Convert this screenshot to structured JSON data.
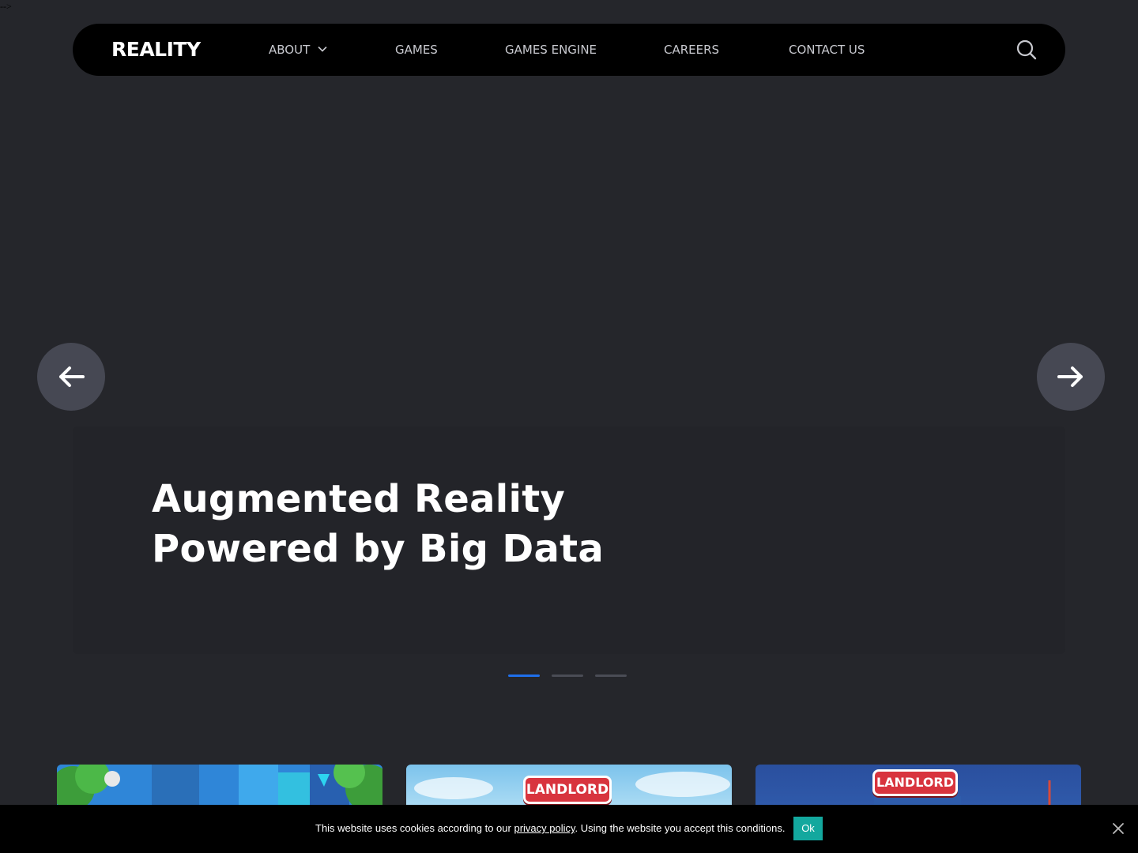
{
  "stray_text": "-->",
  "header": {
    "logo": "REALITY",
    "nav": {
      "about": "ABOUT",
      "games": "GAMES",
      "games_engine": "GAMES ENGINE",
      "careers": "CAREERS",
      "contact": "CONTACT US"
    },
    "search_icon": "search-icon"
  },
  "hero": {
    "title_line1": "Augmented Reality",
    "title_line2": "Powered by Big Data",
    "slide_count": 3,
    "active_slide": 1,
    "prev_icon": "arrow-left-icon",
    "next_icon": "arrow-right-icon"
  },
  "cards": [
    {
      "badge": ""
    },
    {
      "badge": "LANDLORD"
    },
    {
      "badge": "LANDLORD"
    }
  ],
  "cookie": {
    "text_before": "This website uses cookies according to our ",
    "link": "privacy policy",
    "text_after": ". Using the website you accept this conditions.",
    "ok_label": "Ok",
    "close_icon": "close-icon"
  },
  "colors": {
    "background": "#25262b",
    "navbar": "#000000",
    "accent_blue": "#1f6feb",
    "ok_button": "#13a89e",
    "arrow_button": "#464853"
  }
}
